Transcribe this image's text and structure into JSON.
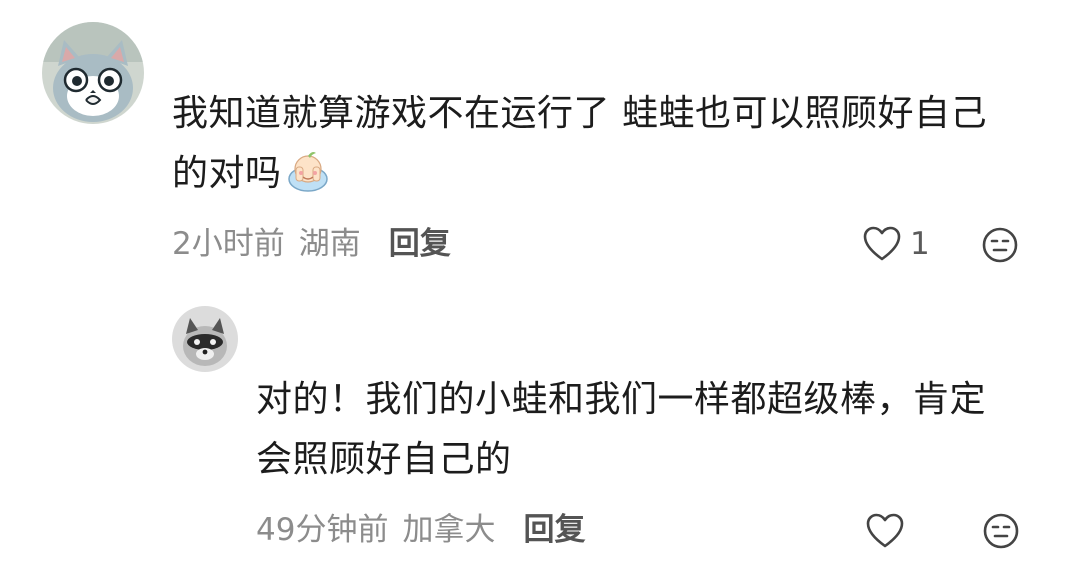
{
  "comments": [
    {
      "author_avatar": "cat-cartoon-avatar",
      "text_line1": "我知道就算游戏不在运行了 蛙蛙也可以照顾好自己",
      "text_line2": "的对吗",
      "emoji": "frog-covering-face-emoji",
      "time": "2小时前",
      "location": "湖南",
      "reply_label": "回复",
      "like_count": "1",
      "like_icon": "heart-outline-icon",
      "dislike_icon": "neutral-face-icon"
    }
  ],
  "replies": [
    {
      "author_avatar": "raccoon-avatar",
      "text_line1": "对的！我们的小蛙和我们一样都超级棒，肯定",
      "text_line2": "会照顾好自己的",
      "time": "49分钟前",
      "location": "加拿大",
      "reply_label": "回复",
      "like_icon": "heart-outline-icon",
      "dislike_icon": "neutral-face-icon"
    }
  ]
}
